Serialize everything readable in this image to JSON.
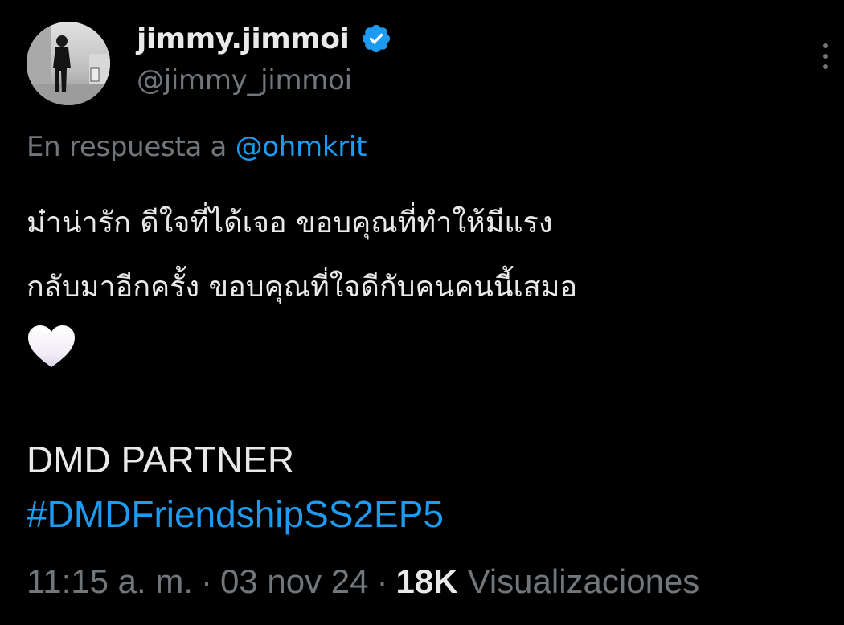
{
  "author": {
    "display_name": "jimmy.jimmoi",
    "handle": "@jimmy_jimmoi",
    "verified": true,
    "verified_color": "#1d9bf0"
  },
  "reply": {
    "prefix": "En respuesta a",
    "mention": "@ohmkrit"
  },
  "tweet": {
    "line1": "ม๋าน่ารัก ดีใจที่ได้เจอ ขอบคุณที่ทำให้มีแรง",
    "line2": "กลับมาอีกครั้ง ขอบคุณที่ใจดีกับคนคนนี้เสมอ",
    "emoji_icon": "white-heart-icon",
    "partner": "DMD PARTNER",
    "hashtag": "#DMDFriendshipSS2EP5"
  },
  "meta": {
    "time": "11:15 a. m.",
    "separator": "·",
    "date": "03 nov 24",
    "views_count": "18K",
    "views_label": "Visualizaciones"
  },
  "colors": {
    "background": "#000000",
    "primary_text": "#e7e9ea",
    "secondary_text": "#71767b",
    "accent": "#1d9bf0"
  }
}
